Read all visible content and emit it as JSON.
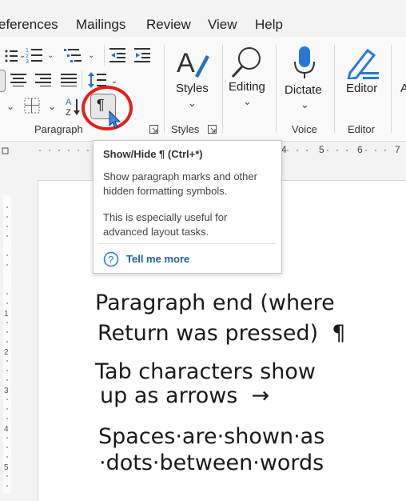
{
  "tabs": [
    "eferences",
    "Mailings",
    "Review",
    "View",
    "Help"
  ],
  "groups": {
    "paragraph": "Paragraph",
    "styles": "Styles",
    "voice": "Voice",
    "editor": "Editor"
  },
  "buttons": {
    "styles": "Styles",
    "editing": "Editing",
    "dictate": "Dictate",
    "editor": "Editor",
    "show_hide_glyph": "¶"
  },
  "ruler_numbers": [
    "4",
    "5",
    "6",
    "7"
  ],
  "tooltip": {
    "title": "Show/Hide ¶ (Ctrl+*)",
    "desc": "Show paragraph marks and other hidden formatting symbols.",
    "extra": "This is especially useful for advanced layout tasks.",
    "link": "Tell me more"
  },
  "document": {
    "line1": "Paragraph end (where",
    "line2": "Return was pressed)  ¶",
    "line3": "Tab characters show",
    "line4": "up as arrows  →",
    "line5": "Spaces·are·shown·as",
    "line6": "·dots·between·words"
  },
  "colors": {
    "highlight_circle": "#e41e1e",
    "cursor": "#2d7be0",
    "link": "#1f5fa8",
    "dictate_mic": "#2a78d6"
  }
}
